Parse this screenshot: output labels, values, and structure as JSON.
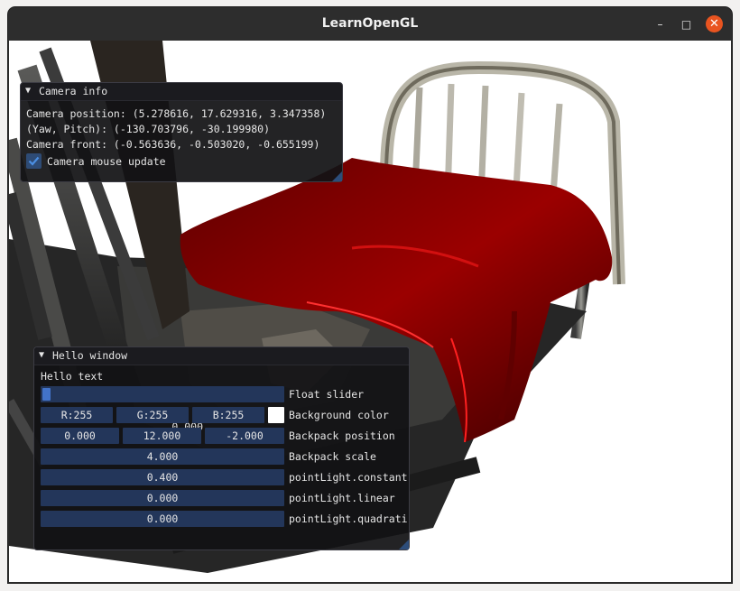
{
  "window": {
    "title": "LearnOpenGL",
    "controls": {
      "minimize": "–",
      "maximize": "□",
      "close": "✕"
    }
  },
  "colors": {
    "accent_close": "#e95420",
    "imgui_field": "#23365a",
    "imgui_check": "#2e4b75",
    "bedsheet": "#8f0000"
  },
  "camera_info": {
    "title": "Camera info",
    "position": "Camera position: (5.278616, 17.629316, 3.347358)",
    "yaw_pitch": "(Yaw, Pitch): (-130.703796, -30.199980)",
    "front": "Camera front: (-0.563636, -0.503020, -0.655199)",
    "mouse_update_label": "Camera mouse update",
    "mouse_update_checked": true
  },
  "hello_window": {
    "title": "Hello window",
    "hello_text": "Hello text",
    "float_slider": {
      "value": "0.000",
      "label": "Float slider",
      "fraction": 0.0
    },
    "background_color": {
      "r": "R:255",
      "g": "G:255",
      "b": "B:255",
      "label": "Background color",
      "swatch": "#ffffff"
    },
    "backpack_position": {
      "x": "0.000",
      "y": "12.000",
      "z": "-2.000",
      "label": "Backpack position"
    },
    "backpack_scale": {
      "value": "4.000",
      "label": "Backpack scale"
    },
    "point_constant": {
      "value": "0.400",
      "label": "pointLight.constant"
    },
    "point_linear": {
      "value": "0.000",
      "label": "pointLight.linear"
    },
    "point_quadratic": {
      "value": "0.000",
      "label": "pointLight.quadrati"
    }
  }
}
